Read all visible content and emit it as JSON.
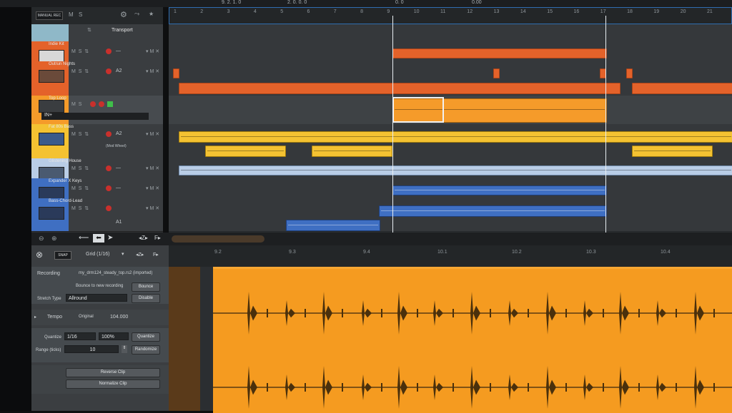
{
  "transport": {
    "position_1": "9. 2. 1. 0",
    "position_2": "2. 0. 0. 0",
    "position_3": "0. 0",
    "position_4": "0.00"
  },
  "track_header": {
    "mode_badge": "MANUAL REC",
    "m_label": "M",
    "s_label": "S"
  },
  "tracks": [
    {
      "name": "Transport",
      "color": "#8fb8c8"
    },
    {
      "name": "Indie Kit",
      "color": "#e4622a",
      "channel": "—"
    },
    {
      "name": "Outrun Nights",
      "color": "#e4622a",
      "channel": "A2"
    },
    {
      "name": "Top Loop",
      "color": "#f59b2a",
      "channel": "IN+"
    },
    {
      "name": "Fat 80s Bass",
      "color": "#f4c232",
      "channel": "A2",
      "automation": "(Mod Wheel)"
    },
    {
      "name": "Glistening House",
      "color": "#b9cde6",
      "channel": "—"
    },
    {
      "name": "Expander X Keys",
      "color": "#3f6fc2",
      "channel": "—"
    },
    {
      "name": "Bass-Chord-Lead",
      "color": "#3f6fc2",
      "channel": "A1"
    }
  ],
  "ruler_ticks": [
    "1",
    "2",
    "3",
    "4",
    "5",
    "6",
    "7",
    "8",
    "9",
    "10",
    "11",
    "12",
    "13",
    "14",
    "15",
    "16",
    "17",
    "18",
    "19",
    "20",
    "21"
  ],
  "editor": {
    "snap_badge": "SNAP",
    "grid_label": "Grid (1/16)",
    "recording_label": "Recording",
    "recording_file": "my_drm124_steady_top.rs2 (imported)",
    "bounce_hint": "Bounce to new recording",
    "bounce_button": "Bounce",
    "stretch_label": "Stretch Type",
    "stretch_value": "Allround",
    "disable_button": "Disable",
    "tempo_label": "Tempo",
    "tempo_mode": "Original",
    "tempo_value": "104.000",
    "quantize_label": "Quantize",
    "quantize_value": "1/16",
    "quantize_percent": "100%",
    "quantize_button": "Quantize",
    "range_label": "Range (ticks)",
    "range_value": "10",
    "randomize_button": "Randomize",
    "reverse_button": "Reverse Clip",
    "normalize_button": "Normalize Clip",
    "ruler_ticks": [
      "9.2",
      "9.3",
      "9.4",
      "10.1",
      "10.2",
      "10.3",
      "10.4"
    ]
  }
}
